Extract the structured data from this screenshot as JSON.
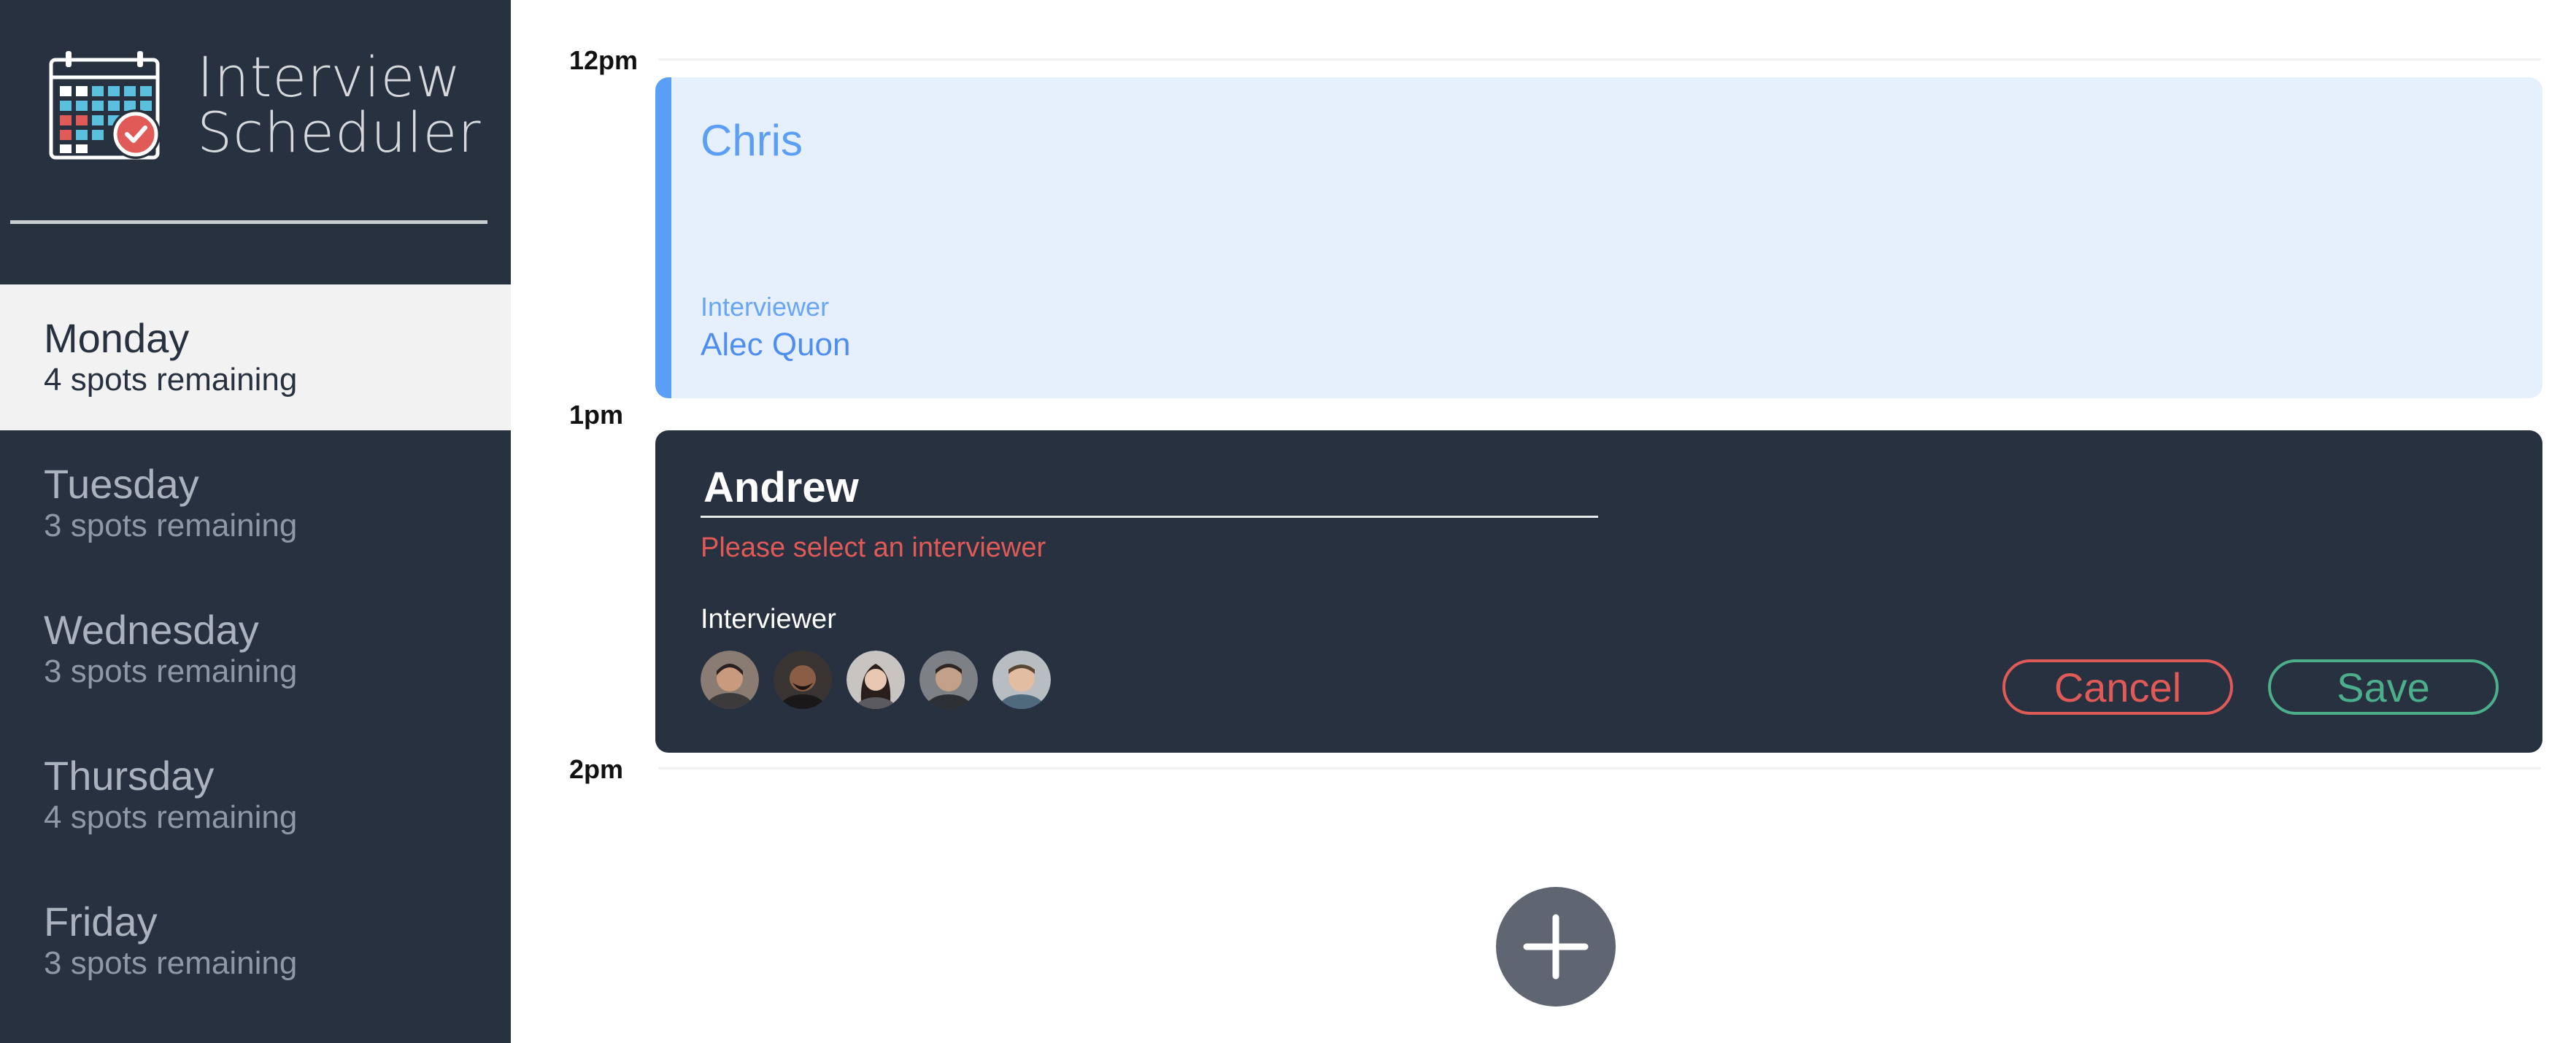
{
  "app": {
    "title_line1": "Interview",
    "title_line2": "Scheduler"
  },
  "days": [
    {
      "name": "Monday",
      "spots": "4 spots remaining",
      "selected": true
    },
    {
      "name": "Tuesday",
      "spots": "3 spots remaining",
      "selected": false
    },
    {
      "name": "Wednesday",
      "spots": "3 spots remaining",
      "selected": false
    },
    {
      "name": "Thursday",
      "spots": "4 spots remaining",
      "selected": false
    },
    {
      "name": "Friday",
      "spots": "3 spots remaining",
      "selected": false
    }
  ],
  "times": [
    "12pm",
    "1pm",
    "2pm"
  ],
  "appointment": {
    "student": "Chris",
    "interviewer_label": "Interviewer",
    "interviewer_name": "Alec Quon"
  },
  "form": {
    "student_value": "Andrew",
    "validation_message": "Please select an interviewer",
    "interviewer_label": "Interviewer",
    "cancel_label": "Cancel",
    "save_label": "Save"
  },
  "colors": {
    "sidebar": "#273140",
    "accent_blue": "#5b9ef5",
    "danger": "#e05a57",
    "success": "#4cae8a"
  },
  "icons": {
    "brand": "calendar-check-icon",
    "add": "plus-icon"
  }
}
